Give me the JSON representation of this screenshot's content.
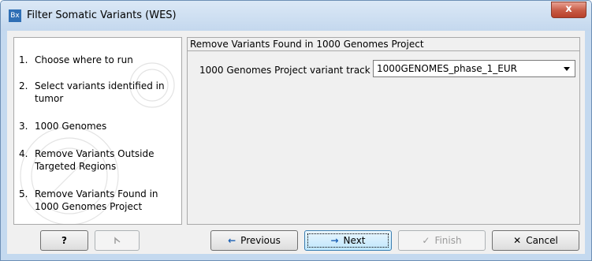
{
  "window": {
    "title": "Filter Somatic Variants (WES)",
    "app_icon_text": "Bx",
    "close_symbol": "x"
  },
  "steps": [
    {
      "num": "1.",
      "label": "Choose where to run"
    },
    {
      "num": "2.",
      "label": "Select variants identified in tumor"
    },
    {
      "num": "3.",
      "label": "1000 Genomes"
    },
    {
      "num": "4.",
      "label": "Remove Variants Outside Targeted Regions"
    },
    {
      "num": "5.",
      "label": "Remove Variants Found in 1000 Genomes Project"
    }
  ],
  "panel": {
    "title": "Remove Variants Found in 1000 Genomes Project",
    "field_label": "1000 Genomes Project variant track",
    "field_value": "1000GENOMES_phase_1_EUR"
  },
  "buttons": {
    "help": "?",
    "reset_icon": "reset-icon",
    "previous": "Previous",
    "next": "Next",
    "finish": "Finish",
    "cancel": "Cancel"
  },
  "colors": {
    "title_bar": "#c4d9ef",
    "close_button": "#c75a44",
    "arrow_blue": "#1a5fb4"
  }
}
